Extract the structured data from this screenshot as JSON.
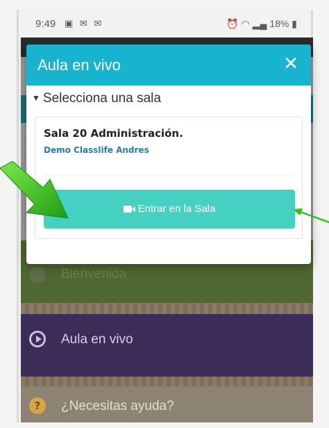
{
  "status_bar": {
    "time": "9:49",
    "left_icons": [
      "image-icon",
      "mail-icon",
      "mail-icon"
    ],
    "battery": "18%"
  },
  "background_menu": {
    "items": [
      {
        "label": "Bienvenida",
        "icon": "info-icon"
      },
      {
        "label": "Aula en vivo",
        "icon": "play-circle-icon"
      },
      {
        "label": "¿Necesitas ayuda?",
        "icon": "question-icon"
      }
    ]
  },
  "modal": {
    "title": "Aula en vivo",
    "close_symbol": "✕",
    "select_header": "Selecciona una sala",
    "room": {
      "name": "Sala 20 Administración.",
      "subtitle": "Demo Classlife Andres"
    },
    "enter_button": "Entrar en la Sala"
  },
  "colors": {
    "modal_header": "#18b3ce",
    "enter_button": "#45d1c2",
    "room_subtitle": "#2a7cb0",
    "arrow": "#2ec21a"
  }
}
